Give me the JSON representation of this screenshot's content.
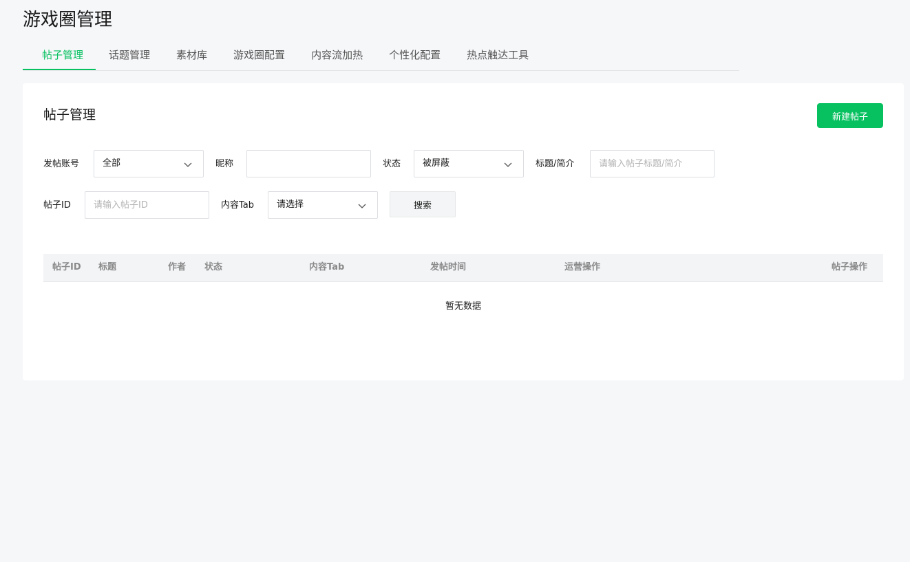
{
  "header": {
    "title": "游戏圈管理"
  },
  "tabs": [
    {
      "label": "帖子管理",
      "active": true
    },
    {
      "label": "话题管理"
    },
    {
      "label": "素材库"
    },
    {
      "label": "游戏圈配置"
    },
    {
      "label": "内容流加热"
    },
    {
      "label": "个性化配置"
    },
    {
      "label": "热点触达工具"
    }
  ],
  "card": {
    "title": "帖子管理",
    "create_button": "新建帖子"
  },
  "filters": {
    "account": {
      "label": "发帖账号",
      "value": "全部"
    },
    "nickname": {
      "label": "昵称",
      "value": ""
    },
    "status": {
      "label": "状态",
      "value": "被屏蔽"
    },
    "title": {
      "label": "标题/简介",
      "placeholder": "请输入帖子标题/简介"
    },
    "post_id": {
      "label": "帖子ID",
      "placeholder": "请输入帖子ID"
    },
    "content_tab": {
      "label": "内容Tab",
      "value": "请选择"
    },
    "search_button": "搜索"
  },
  "table": {
    "columns": [
      "帖子ID",
      "标题",
      "作者",
      "状态",
      "内容Tab",
      "发帖时间",
      "运营操作",
      "帖子操作"
    ],
    "empty_text": "暂无数据"
  },
  "colors": {
    "accent": "#07c160"
  },
  "icons": {
    "dropdown": "chevron-down-icon"
  }
}
